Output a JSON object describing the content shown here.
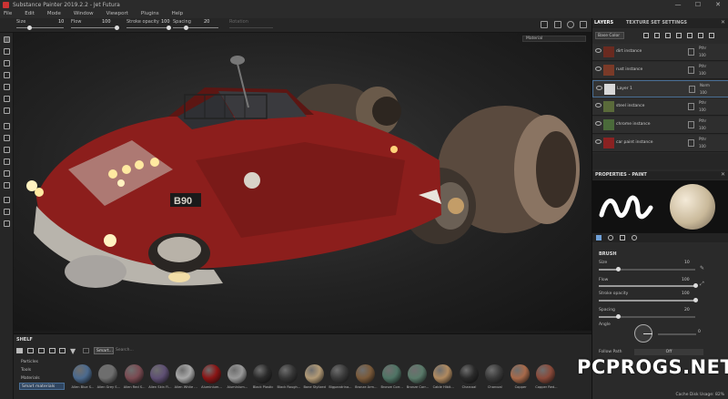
{
  "window": {
    "title": "Substance Painter 2019.2.2 - Jet Futura",
    "min": "—",
    "max": "☐",
    "close": "✕"
  },
  "menu": [
    "File",
    "Edit",
    "Mode",
    "Window",
    "Viewport",
    "Plugins",
    "Help"
  ],
  "toolbar": {
    "size_label": "Size",
    "size_value": "10",
    "flow_label": "Flow",
    "flow_value": "100",
    "opacity_label": "Stroke opacity",
    "opacity_value": "100",
    "spacing_label": "Spacing",
    "spacing_value": "20",
    "angle_label": "Rotation"
  },
  "viewport": {
    "material_select": "Material",
    "decal_text": "B90"
  },
  "shelf": {
    "title": "SHELF",
    "categories": [
      "Particles",
      "Tools",
      "Materials",
      "Smart materials"
    ],
    "search_tag": "Smart...",
    "search_placeholder": "Search...",
    "materials": [
      {
        "name": "Alien Blue S...",
        "color": "#4b6a8e"
      },
      {
        "name": "Alien Grey S...",
        "color": "#6e6e6e"
      },
      {
        "name": "Alien Red S...",
        "color": "#7a4b52"
      },
      {
        "name": "Alien Skin Fl...",
        "color": "#5e4f73"
      },
      {
        "name": "Alien White ...",
        "color": "#a8a8a8"
      },
      {
        "name": "Aluminium...",
        "color": "#8a1515"
      },
      {
        "name": "Aluminium...",
        "color": "#999999"
      },
      {
        "name": "Black Plastic",
        "color": "#2a2a2a"
      },
      {
        "name": "Black Rough...",
        "color": "#353535"
      },
      {
        "name": "Bone Stylized",
        "color": "#b29a76"
      },
      {
        "name": "Bigpandrina...",
        "color": "#3a3a3a"
      },
      {
        "name": "Bronze Arm...",
        "color": "#7a5a3a"
      },
      {
        "name": "Bronze Corr...",
        "color": "#4f7465"
      },
      {
        "name": "Bronze Corr...",
        "color": "#5a7a6a"
      },
      {
        "name": "Cable Hibit...",
        "color": "#b08a60"
      },
      {
        "name": "Charcoal",
        "color": "#2a2a2a"
      },
      {
        "name": "Charcoal",
        "color": "#3a3a3a"
      },
      {
        "name": "Copper",
        "color": "#a86a4a"
      },
      {
        "name": "Copper Red...",
        "color": "#8a4a3a"
      }
    ]
  },
  "layers": {
    "tabs": [
      "LAYERS",
      "TEXTURE SET SETTINGS"
    ],
    "channel": "Base Color",
    "items": [
      {
        "name": "dirt instance",
        "blend": "Pthr",
        "opacity": "100",
        "thumb": "#6a2a20"
      },
      {
        "name": "rust instance",
        "blend": "Pthr",
        "opacity": "100",
        "thumb": "#7a3a28"
      },
      {
        "name": "Layer 1",
        "blend": "Norm",
        "opacity": "100",
        "thumb": "#d8d8d8"
      },
      {
        "name": "steel instance",
        "blend": "Pthr",
        "opacity": "100",
        "thumb": "#5a6a3a"
      },
      {
        "name": "chrome instance",
        "blend": "Pthr",
        "opacity": "100",
        "thumb": "#4a6a3a"
      },
      {
        "name": "car paint instance",
        "blend": "Pthr",
        "opacity": "100",
        "thumb": "#8a2222"
      }
    ]
  },
  "properties": {
    "title": "PROPERTIES - PAINT",
    "section": "BRUSH",
    "size": {
      "label": "Size",
      "value": "10",
      "level": 0.2
    },
    "flow": {
      "label": "Flow",
      "value": "100",
      "level": 1.0
    },
    "opacity": {
      "label": "Stroke opacity",
      "value": "100",
      "level": 1.0
    },
    "spacing": {
      "label": "Spacing",
      "value": "20",
      "level": 0.2
    },
    "angle": {
      "label": "Angle",
      "value": "0"
    },
    "follow": {
      "label": "Follow Path",
      "value": "Off"
    }
  },
  "status": "Cache Disk Usage: 82%",
  "watermark": "PCPROGS.NET"
}
